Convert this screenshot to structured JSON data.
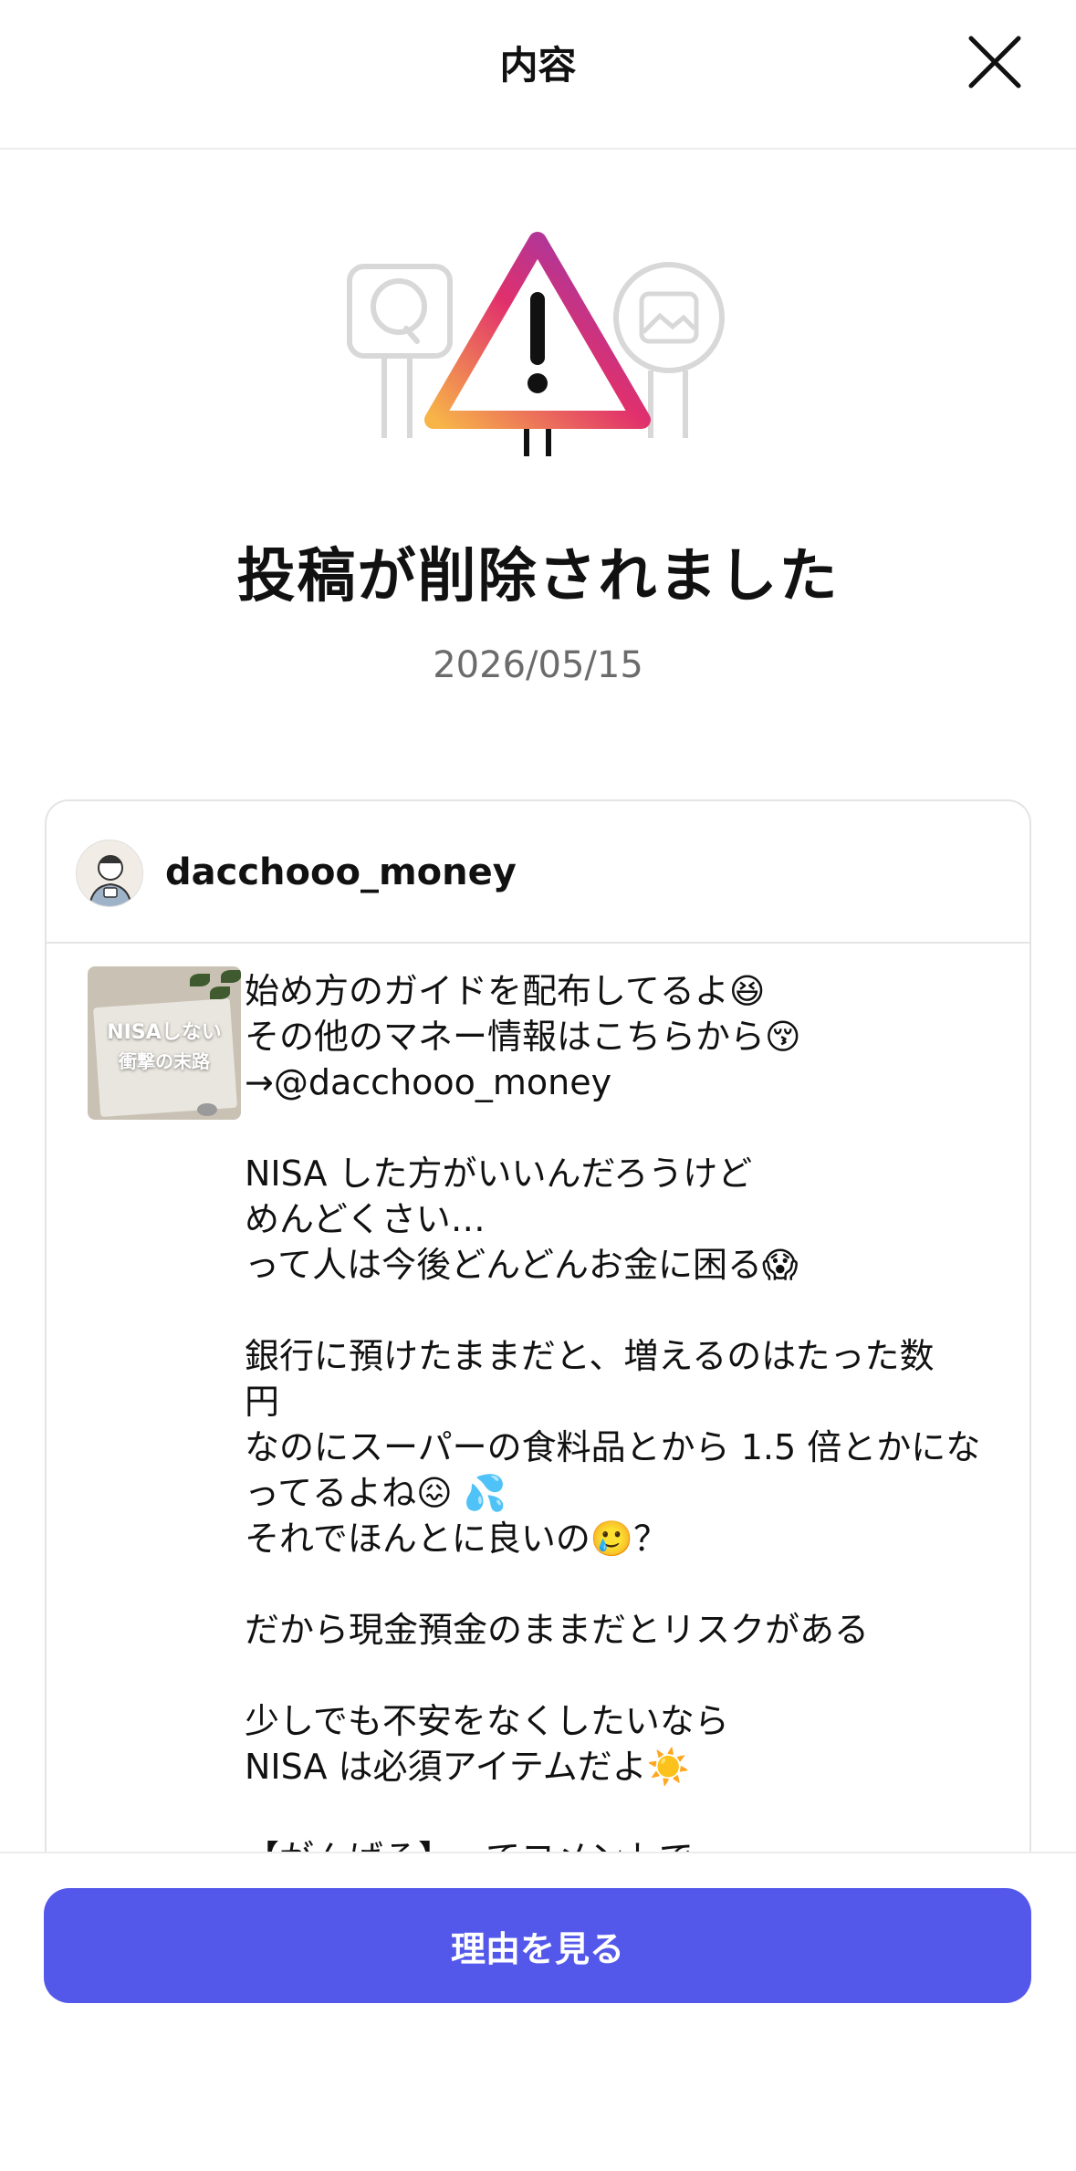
{
  "header": {
    "title": "内容",
    "close_icon": "close-icon"
  },
  "notice": {
    "title": "投稿が削除されました",
    "date": "2026/05/15",
    "icon": "warning-icon",
    "gradient": [
      "#f7b548",
      "#e1306c",
      "#8a3ab9"
    ]
  },
  "post": {
    "username": "dacchooo_money",
    "thumbnail_text_line1": "NISAしない",
    "thumbnail_text_line2": "衝撃の末路",
    "caption_lines": [
      "始め方のガイドを配布してるよ😆",
      "その他のマネー情報はこちらから😚",
      "→@dacchooo_money",
      "",
      "NISA した方がいいんだろうけど",
      "めんどくさい…",
      "って人は今後どんどんお金に困る😱",
      "",
      "銀行に預けたままだと、増えるのはたった数",
      "円",
      "なのにスーパーの食料品とから 1.5 倍とかにな",
      "ってるよね😖 💦",
      "それでほんとに良いの🥲？",
      "",
      "だから現金預金のままだとリスクがある",
      "",
      "少しでも不安をなくしたいなら",
      "NISA は必須アイテムだよ☀️",
      "",
      "【がんばる】ってコメントで"
    ]
  },
  "footer": {
    "button_label": "理由を見る",
    "button_color": "#5458ea"
  }
}
